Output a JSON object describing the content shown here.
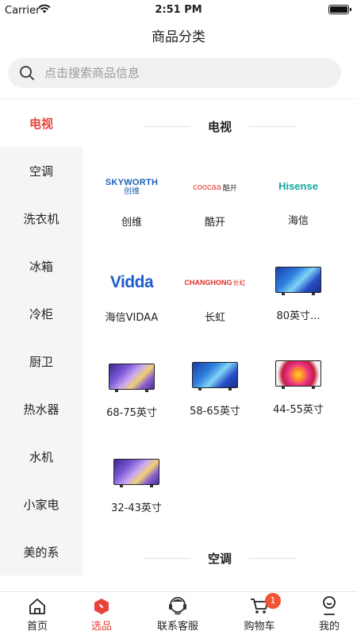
{
  "status_bar": {
    "carrier": "Carrier",
    "time": "2:51 PM"
  },
  "header": {
    "title": "商品分类"
  },
  "search": {
    "placeholder": "点击搜索商品信息"
  },
  "sidebar": {
    "items": [
      {
        "label": "电视",
        "active": true
      },
      {
        "label": "空调"
      },
      {
        "label": "洗衣机"
      },
      {
        "label": "冰箱"
      },
      {
        "label": "冷柜"
      },
      {
        "label": "厨卫"
      },
      {
        "label": "热水器"
      },
      {
        "label": "水机"
      },
      {
        "label": "小家电"
      },
      {
        "label": "美的系"
      }
    ]
  },
  "content": {
    "section_title": "电视",
    "next_section_title": "空调",
    "items": [
      {
        "label": "创维",
        "image": "skyworth-logo",
        "logo_text": "SKYWORTH",
        "logo_sub": "创维"
      },
      {
        "label": "酷开",
        "image": "coocaa-logo",
        "logo_text": "coocaa",
        "logo_sub": "酷开"
      },
      {
        "label": "海信",
        "image": "hisense-logo",
        "logo_text": "Hisense"
      },
      {
        "label": "海信VIDAA",
        "image": "vidda-logo",
        "logo_text": "Vidda"
      },
      {
        "label": "长虹",
        "image": "changhong-logo",
        "logo_text": "CHANGHONG",
        "logo_sub": "长虹"
      },
      {
        "label": "80英寸...",
        "image": "tv-blue-image"
      },
      {
        "label": "68-75英寸",
        "image": "tv-purple-image"
      },
      {
        "label": "58-65英寸",
        "image": "tv-blue-image"
      },
      {
        "label": "44-55英寸",
        "image": "tv-red-image"
      },
      {
        "label": "32-43英寸",
        "image": "tv-purple-image"
      }
    ]
  },
  "tabbar": {
    "items": [
      {
        "label": "首页",
        "icon": "home-icon"
      },
      {
        "label": "选品",
        "icon": "select-icon",
        "active": true
      },
      {
        "label": "联系客服",
        "icon": "customer-service-icon"
      },
      {
        "label": "购物车",
        "icon": "cart-icon",
        "badge": "1"
      },
      {
        "label": "我的",
        "icon": "profile-icon"
      }
    ]
  },
  "colors": {
    "accent": "#e8423a",
    "badge": "#ef5533",
    "sidebar_bg": "#f5f5f5",
    "search_bg": "#f1f1f1"
  }
}
